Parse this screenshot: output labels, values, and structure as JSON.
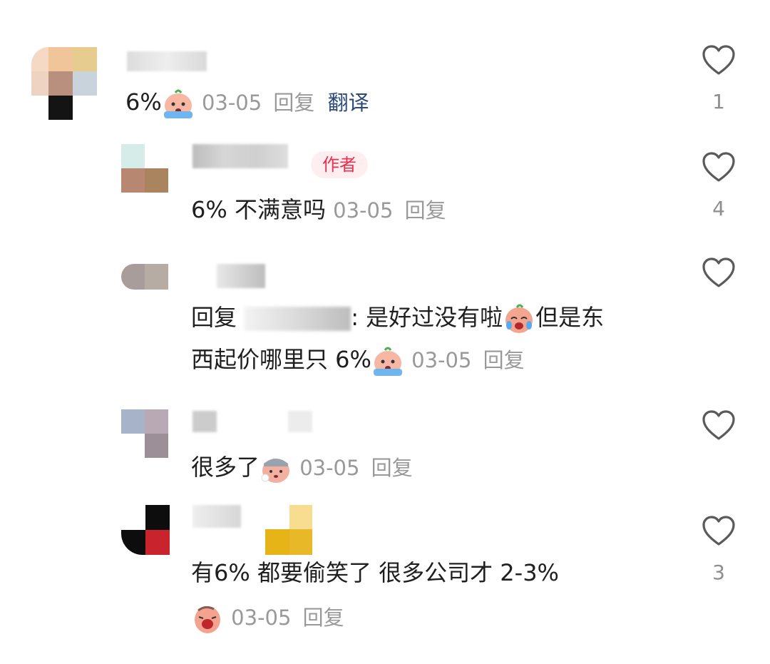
{
  "comments": [
    {
      "text": "6%",
      "date": "03-05",
      "reply_label": "回复",
      "translate_label": "翻译",
      "likes": "1"
    },
    {
      "author_badge": "作者",
      "text": "6% 不满意吗",
      "date": "03-05",
      "reply_label": "回复",
      "likes": "4"
    },
    {
      "reply_prefix": "回复",
      "text_after_name": ": 是好过没有啦",
      "text_line1_end": "但是东",
      "text_line2": "西起价哪里只 6%",
      "date": "03-05",
      "reply_label": "回复",
      "likes": ""
    },
    {
      "text": "很多了",
      "date": "03-05",
      "reply_label": "回复",
      "likes": ""
    },
    {
      "text": "有6% 都要偷笑了 很多公司才 2-3%",
      "date": "03-05",
      "reply_label": "回复",
      "likes": "3"
    }
  ],
  "icons": {
    "like": "heart-outline-icon",
    "emoji_cry": "crying-emoji",
    "emoji_tears": "tearful-emoji",
    "emoji_sigh": "sigh-emoji",
    "emoji_wail": "wailing-emoji"
  },
  "colors": {
    "meta": "#999999",
    "translate": "#2b4a7a",
    "badge_text": "#ee2d4f",
    "badge_bg": "#ffeef0"
  }
}
